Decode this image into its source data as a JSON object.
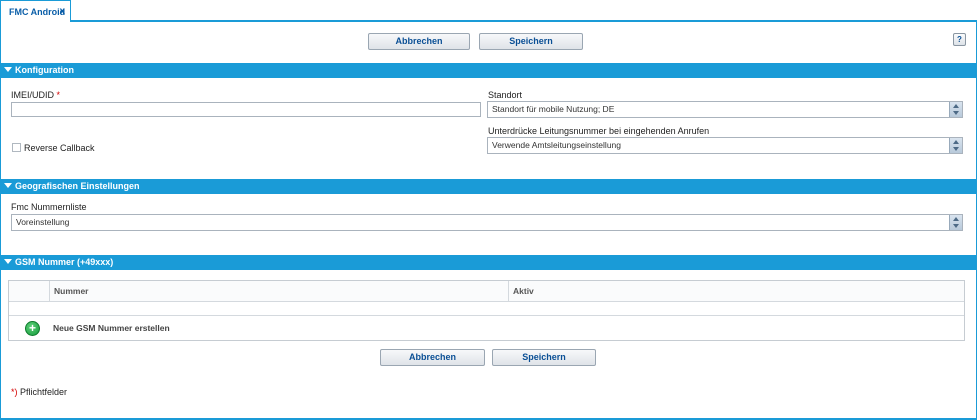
{
  "tab": {
    "title": "FMC Android",
    "close": "x"
  },
  "toolbar": {
    "cancel": "Abbrechen",
    "save": "Speichern",
    "help": "?"
  },
  "sections": {
    "config": "Konfiguration",
    "geo": "Geografischen Einstellungen",
    "gsm": "GSM Nummer (+49xxx)"
  },
  "config": {
    "imei_label": "IMEI/UDID",
    "required_marker": "*",
    "imei_value": "",
    "standort_label": "Standort",
    "standort_value": "Standort für mobile Nutzung; DE",
    "suppress_label": "Unterdrücke Leitungsnummer bei eingehenden Anrufen",
    "suppress_value": "Verwende Amtsleitungseinstellung",
    "reverse_callback_label": "Reverse Callback",
    "reverse_callback_checked": false
  },
  "geo": {
    "fmc_label": "Fmc Nummernliste",
    "fmc_value": "Voreinstellung"
  },
  "gsm": {
    "columns": [
      "",
      "Nummer",
      "Aktiv"
    ],
    "new_label": "Neue GSM Nummer erstellen"
  },
  "footer": {
    "cancel": "Abbrechen",
    "save": "Speichern",
    "required_note": "Pflichtfelder",
    "required_marker": "*)"
  }
}
